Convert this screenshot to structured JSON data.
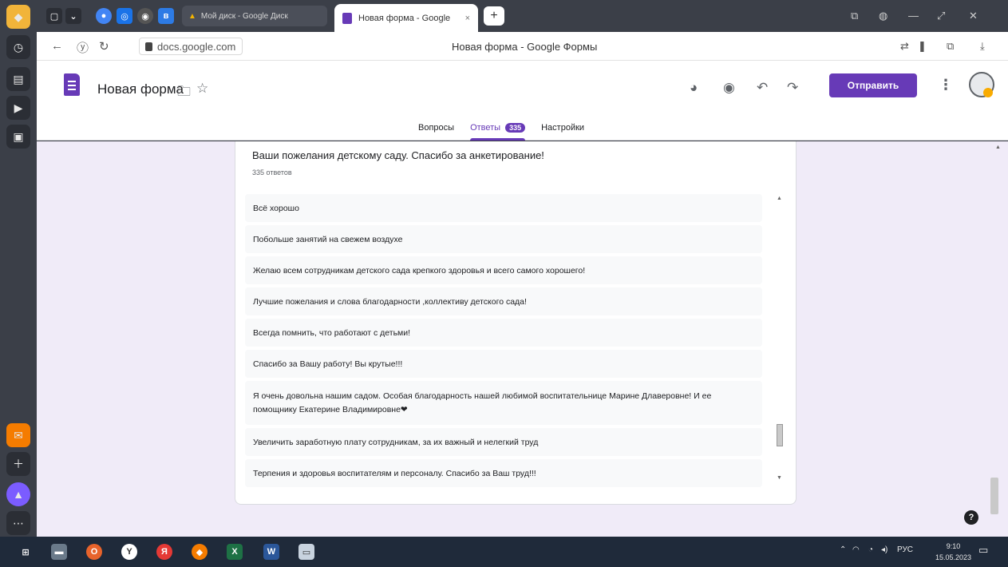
{
  "browser": {
    "tabs": [
      {
        "label": "Мой диск - Google Диск",
        "active": false
      },
      {
        "label": "Новая форма - Google",
        "active": true
      }
    ],
    "url": "docs.google.com",
    "page_title": "Новая форма - Google Формы"
  },
  "form_header": {
    "title": "Новая форма",
    "send_label": "Отправить",
    "tabs": [
      {
        "label": "Вопросы"
      },
      {
        "label": "Ответы",
        "badge": "335"
      },
      {
        "label": "Настройки"
      }
    ],
    "accent": "#673ab7"
  },
  "question": {
    "title": "Ваши пожелания детскому саду. Спасибо за анкетирование!",
    "count_text": "335 ответов",
    "answers": [
      "Всё хорошо",
      "Побольше занятий на свежем воздухе",
      "Желаю всем сотрудникам детского сада крепкого здоровья и всего самого хорошего!",
      "Лучшие пожелания и слова благодарности ,коллективу детского сада!",
      "Всегда помнить, что работают с детьми!",
      "Спасибо за Вашу работу! Вы крутые!!!",
      "Я очень довольна нашим садом. Особая благодарность нашей любимой воспитательнице Марине Длаверовне! И ее помощнику Екатерине Владимировне❤",
      "Увеличить заработную плату сотрудникам, за их важный и нелегкий труд",
      "Терпения и здоровья воспитателям и персоналу. Спасибо за Ваш труд!!!"
    ]
  },
  "taskbar": {
    "lang": "РУС",
    "time": "9:10",
    "date": "15.05.2023"
  }
}
